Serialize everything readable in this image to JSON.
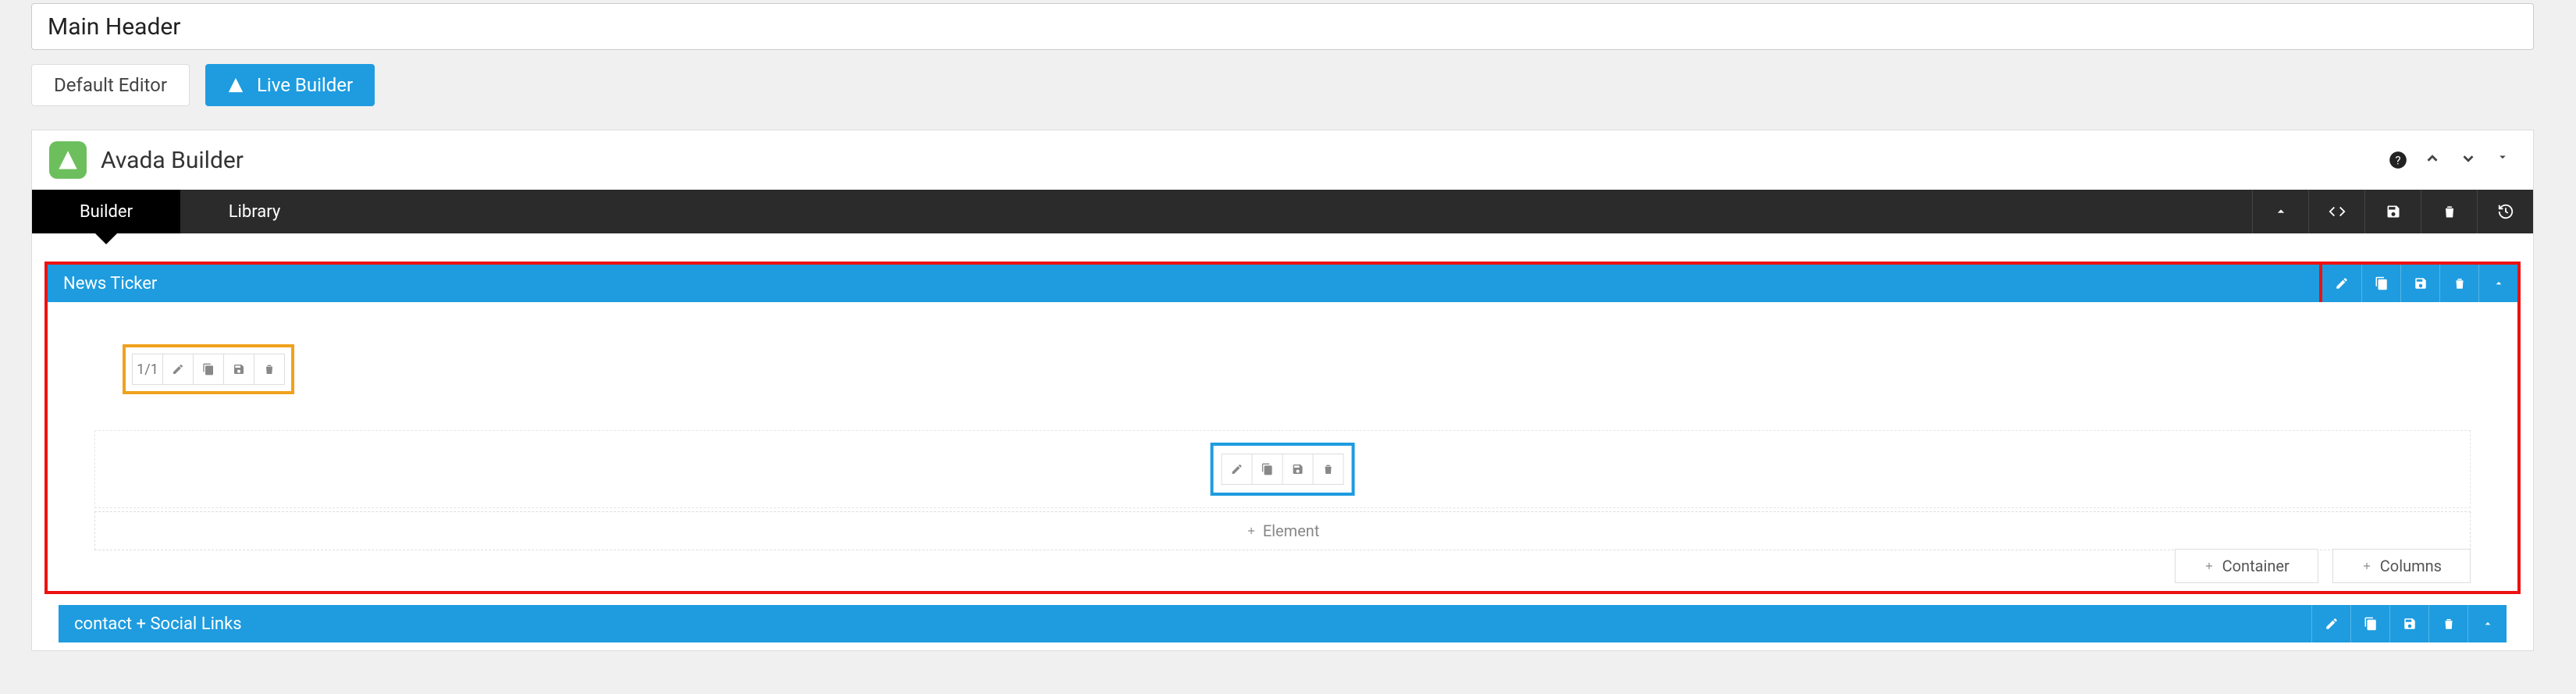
{
  "header": {
    "title_value": "Main Header",
    "default_editor_label": "Default Editor",
    "live_builder_label": "Live Builder"
  },
  "builder": {
    "brand_title": "Avada Builder",
    "tabs": {
      "builder": "Builder",
      "library": "Library"
    }
  },
  "container1": {
    "title": "News Ticker",
    "column_ratio": "1/1",
    "add_element_label": "Element",
    "add_container_label": "Container",
    "add_columns_label": "Columns"
  },
  "container2": {
    "title": "contact + Social Links"
  },
  "icons": {
    "help": "help-icon",
    "up": "chevron-up-icon",
    "down": "chevron-down-icon",
    "toggle": "caret-toggle",
    "caretUp": "caret-up-icon",
    "code": "code-icon",
    "save": "save-icon",
    "trash": "trash-icon",
    "history": "history-icon",
    "edit": "pencil-icon",
    "clone": "clone-icon",
    "collapse": "caret-up-icon",
    "plus": "plus-icon",
    "logo": "avada-logo-icon"
  },
  "colors": {
    "primary": "#1e9cdf",
    "highlight_red": "#e11",
    "highlight_orange": "#f0a11c",
    "highlight_blue": "#1e9cdf"
  }
}
